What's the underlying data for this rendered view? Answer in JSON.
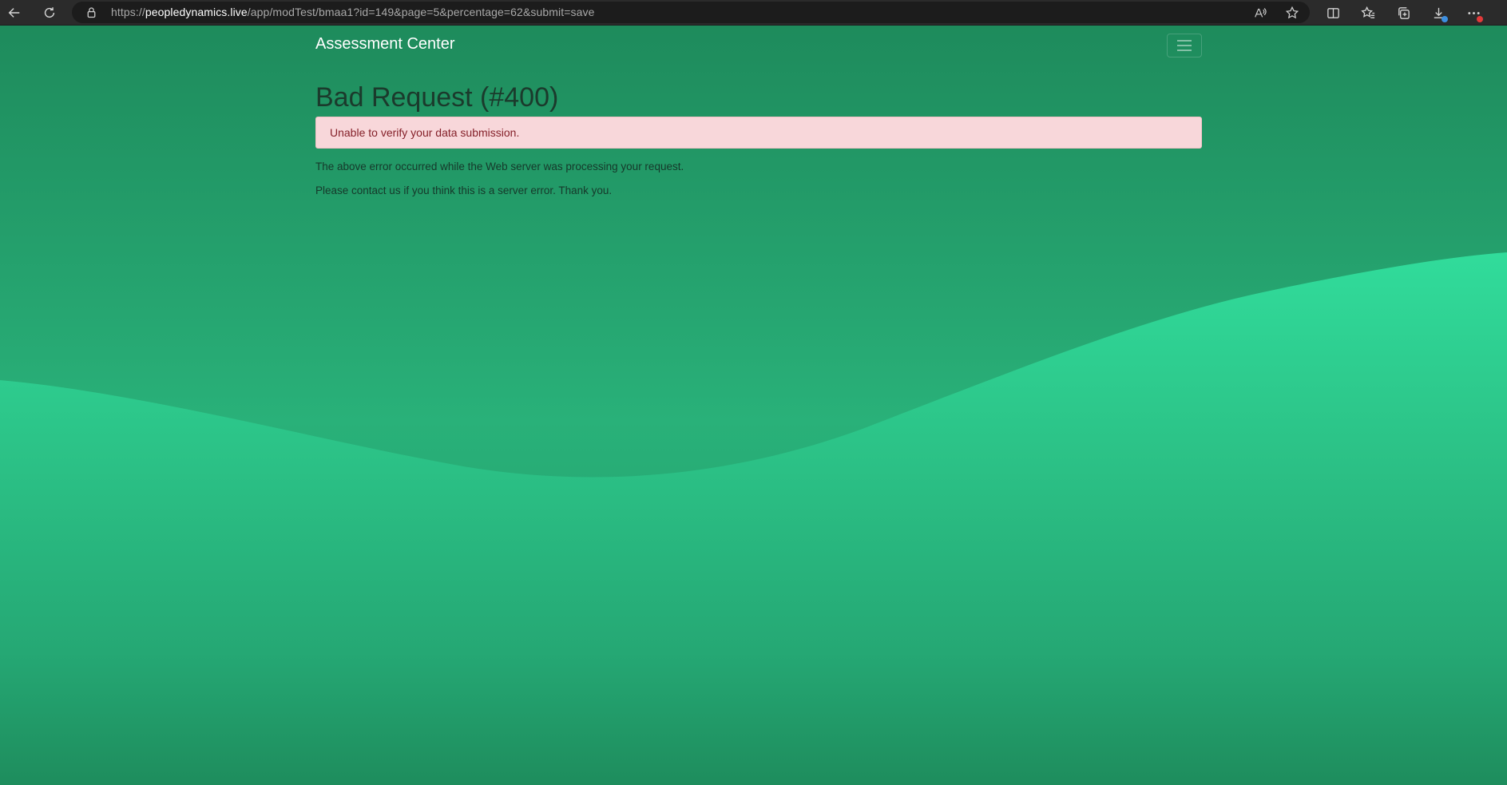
{
  "browser": {
    "url_prefix": "https://",
    "url_host": "peopledynamics.live",
    "url_path": "/app/modTest/bmaa1?id=149&page=5&percentage=62&submit=save",
    "icons": [
      "back-arrow-icon",
      "reload-icon",
      "lock-icon",
      "read-aloud-icon",
      "favorite-star-icon",
      "split-screen-icon",
      "favorites-icon",
      "collections-icon",
      "downloads-icon",
      "more-icon"
    ]
  },
  "navbar": {
    "brand": "Assessment Center",
    "toggle_icon": "hamburger-icon"
  },
  "error": {
    "title": "Bad Request (#400)",
    "alert_message": "Unable to verify your data submission.",
    "paragraph_1": "The above error occurred while the Web server was processing your request.",
    "paragraph_2": "Please contact us if you think this is a server error. Thank you."
  },
  "colors": {
    "background": "#1f8c5e",
    "wave": "#30d898",
    "alert_bg": "#f8d7da",
    "alert_text": "#842029",
    "title_text": "#1b3a2c"
  }
}
